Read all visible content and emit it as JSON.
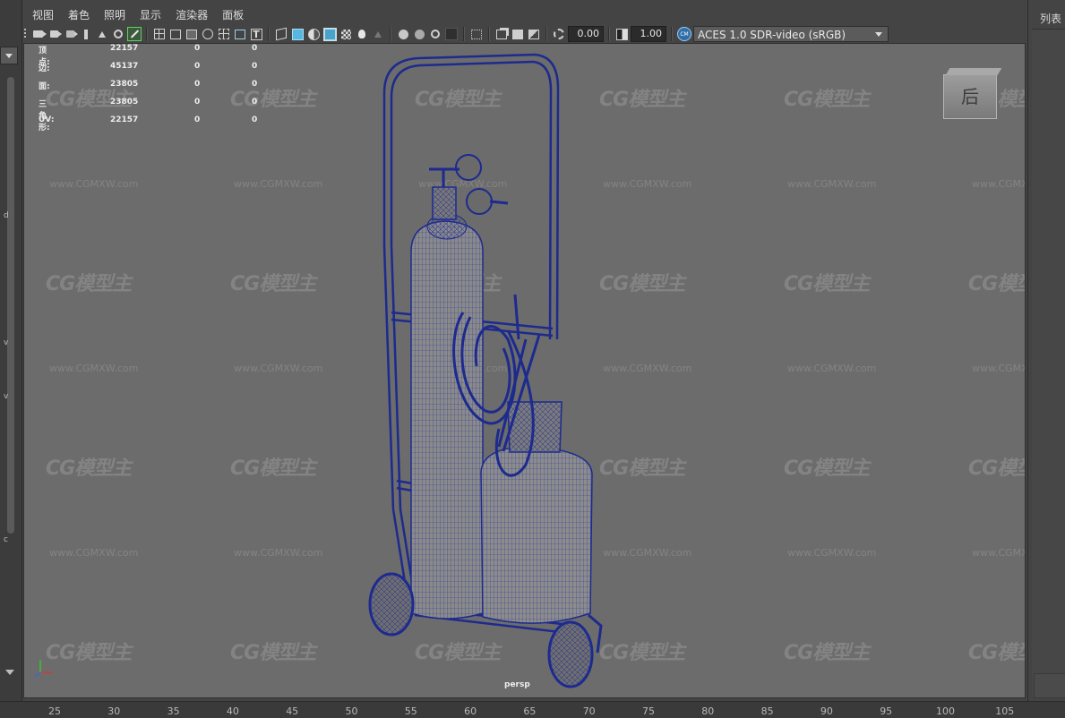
{
  "menubar": {
    "items": [
      "视图",
      "着色",
      "照明",
      "显示",
      "渲染器",
      "面板"
    ]
  },
  "toolbar": {
    "icons": [
      "select-camera-icon",
      "camera-attributes-icon",
      "bookmark-icon",
      "image-plane-icon",
      "camera-manipulator-icon",
      "grease-pencil-icon",
      "grid-icon",
      "film-gate-icon",
      "resolution-gate-icon",
      "gate-mask-icon",
      "field-chart-icon",
      "safe-action-icon",
      "safe-title-icon",
      "wireframe-icon",
      "smooth-shade-icon",
      "default-material-icon",
      "wireframe-on-shaded-icon",
      "textured-icon",
      "use-all-lights-icon",
      "shadows-icon",
      "screen-space-ao-icon",
      "motion-blur-icon",
      "multisample-aa-icon",
      "depth-of-field-icon",
      "isolate-select-icon",
      "xray-icon",
      "xray-joints-icon",
      "xray-active-components-icon",
      "backface-culling-icon",
      "exposure-icon",
      "gamma-icon"
    ],
    "exposure_value": "0.00",
    "gamma_value": "1.00",
    "color_space": "ACES 1.0 SDR-video (sRGB)"
  },
  "right_panel": {
    "tab_label": "列表"
  },
  "hud": {
    "rows": [
      {
        "label": "顶点:",
        "c1": "22157",
        "c2": "0",
        "c3": "0"
      },
      {
        "label": "边:",
        "c1": "45137",
        "c2": "0",
        "c3": "0"
      },
      {
        "label": "面:",
        "c1": "23805",
        "c2": "0",
        "c3": "0"
      },
      {
        "label": "三角形:",
        "c1": "23805",
        "c2": "0",
        "c3": "0"
      },
      {
        "label": "UV:",
        "c1": "22157",
        "c2": "0",
        "c3": "0"
      }
    ]
  },
  "viewcube": {
    "label": "后"
  },
  "camera_label": "persp",
  "watermark": {
    "logo": "CG模型主",
    "url": "www.CGMXW.com"
  },
  "ruler": {
    "ticks": [
      "25",
      "30",
      "35",
      "40",
      "45",
      "50",
      "55",
      "60",
      "65",
      "70",
      "75",
      "80",
      "85",
      "90",
      "95",
      "100",
      "105"
    ]
  },
  "left_strip": {
    "cut_labels": [
      "d",
      "v",
      "v",
      "c"
    ]
  },
  "colors": {
    "wire": "#1e2a8c",
    "viewport_bg": "#6c6c6c",
    "chrome": "#444444"
  }
}
